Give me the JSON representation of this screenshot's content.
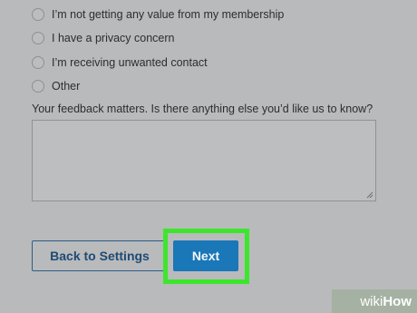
{
  "options": [
    {
      "label": "I’m not getting any value from my membership",
      "selected": false
    },
    {
      "label": "I have a privacy concern",
      "selected": false
    },
    {
      "label": "I’m receiving unwanted contact",
      "selected": false
    },
    {
      "label": "Other",
      "selected": false
    }
  ],
  "feedback": {
    "label": "Your feedback matters. Is there anything else you’d like us to know?",
    "value": ""
  },
  "buttons": {
    "back_label": "Back to Settings",
    "next_label": "Next"
  },
  "watermark": {
    "wiki": "wiki",
    "how": "How"
  },
  "colors": {
    "background": "#b9babc",
    "next_button": "#1a77b8",
    "highlight": "#3de62c",
    "back_button_text": "#1f4b74"
  }
}
